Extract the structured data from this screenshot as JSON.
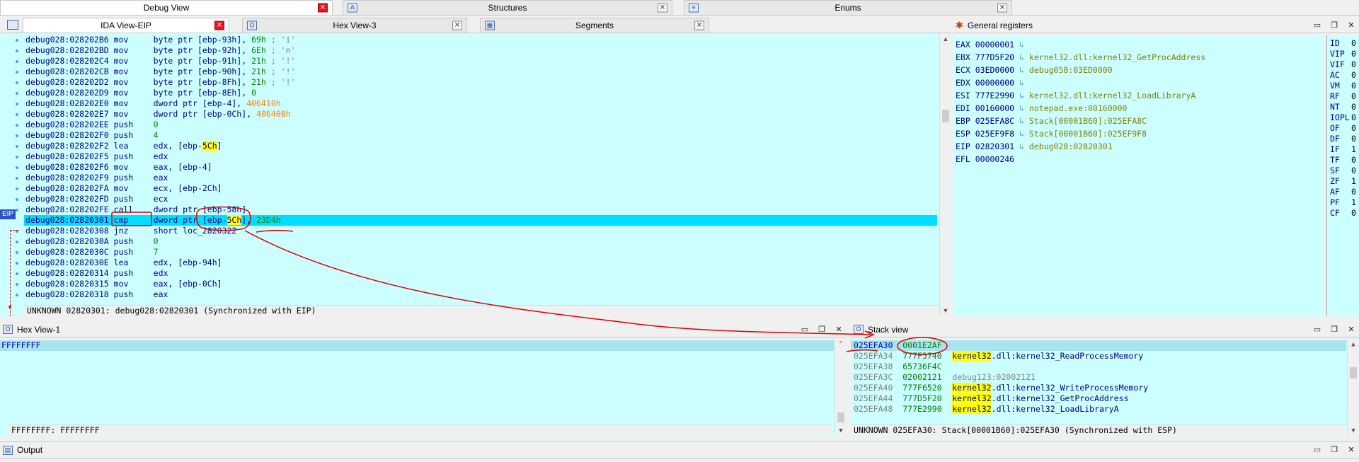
{
  "top_tabs": [
    {
      "label": "Debug View"
    },
    {
      "label": "Structures"
    },
    {
      "label": "Enums"
    }
  ],
  "ida_tabs": [
    {
      "label": "IDA View-EIP"
    },
    {
      "label": "Hex View-3"
    },
    {
      "label": "Segments"
    }
  ],
  "eip_marker": "EIP",
  "disasm": [
    {
      "addr": "debug028:028202B6",
      "mn": "mov",
      "op": "byte ptr [ebp-93h], ",
      "num": "69h",
      "cmt": " ; 'i'"
    },
    {
      "addr": "debug028:028202BD",
      "mn": "mov",
      "op": "byte ptr [ebp-92h], ",
      "num": "6Eh",
      "cmt": " ; 'n'"
    },
    {
      "addr": "debug028:028202C4",
      "mn": "mov",
      "op": "byte ptr [ebp-91h], ",
      "num": "21h",
      "cmt": " ; '!'"
    },
    {
      "addr": "debug028:028202CB",
      "mn": "mov",
      "op": "byte ptr [ebp-90h], ",
      "num": "21h",
      "cmt": " ; '!'"
    },
    {
      "addr": "debug028:028202D2",
      "mn": "mov",
      "op": "byte ptr [ebp-8Fh], ",
      "num": "21h",
      "cmt": " ; '!'"
    },
    {
      "addr": "debug028:028202D9",
      "mn": "mov",
      "op": "byte ptr [ebp-8Eh], ",
      "num": "0",
      "cmt": ""
    },
    {
      "addr": "debug028:028202E0",
      "mn": "mov",
      "op": "dword ptr [ebp-4], ",
      "num": "406410h",
      "cmt": "",
      "orange": true
    },
    {
      "addr": "debug028:028202E7",
      "mn": "mov",
      "op": "dword ptr [ebp-0Ch], ",
      "num": "406408h",
      "cmt": "",
      "orange": true
    },
    {
      "addr": "debug028:028202EE",
      "mn": "push",
      "op": "",
      "num": "0",
      "cmt": ""
    },
    {
      "addr": "debug028:028202F0",
      "mn": "push",
      "op": "",
      "num": "4",
      "cmt": ""
    },
    {
      "addr": "debug028:028202F2",
      "mn": "lea",
      "op": "edx, [ebp-",
      "hl": "5Ch",
      "op2": "]",
      "num": "",
      "cmt": ""
    },
    {
      "addr": "debug028:028202F5",
      "mn": "push",
      "op": "edx",
      "num": "",
      "cmt": ""
    },
    {
      "addr": "debug028:028202F6",
      "mn": "mov",
      "op": "eax, [ebp-4]",
      "num": "",
      "cmt": ""
    },
    {
      "addr": "debug028:028202F9",
      "mn": "push",
      "op": "eax",
      "num": "",
      "cmt": ""
    },
    {
      "addr": "debug028:028202FA",
      "mn": "mov",
      "op": "ecx, [ebp-2Ch]",
      "num": "",
      "cmt": ""
    },
    {
      "addr": "debug028:028202FD",
      "mn": "push",
      "op": "ecx",
      "num": "",
      "cmt": ""
    },
    {
      "addr": "debug028:028202FE",
      "mn": "call",
      "op": "dword ptr [ebp-58h]",
      "num": "",
      "cmt": ""
    },
    {
      "addr": "debug028:02820301",
      "mn": "cmp",
      "op": "dword ptr [ebp-",
      "hl": "5Ch",
      "op2": "], ",
      "num": "23D4h",
      "cmt": "",
      "eip": true
    },
    {
      "addr": "debug028:02820308",
      "mn": "jnz",
      "op": "short loc_2820322",
      "num": "",
      "cmt": ""
    },
    {
      "addr": "debug028:0282030A",
      "mn": "push",
      "op": "",
      "num": "0",
      "cmt": ""
    },
    {
      "addr": "debug028:0282030C",
      "mn": "push",
      "op": "",
      "num": "7",
      "cmt": ""
    },
    {
      "addr": "debug028:0282030E",
      "mn": "lea",
      "op": "edx, [ebp-94h]",
      "num": "",
      "cmt": ""
    },
    {
      "addr": "debug028:02820314",
      "mn": "push",
      "op": "edx",
      "num": "",
      "cmt": ""
    },
    {
      "addr": "debug028:02820315",
      "mn": "mov",
      "op": "eax, [ebp-0Ch]",
      "num": "",
      "cmt": ""
    },
    {
      "addr": "debug028:02820318",
      "mn": "push",
      "op": "eax",
      "num": "",
      "cmt": ""
    }
  ],
  "ida_status": "UNKNOWN 02820301: debug028:02820301 (Synchronized with EIP)",
  "registers_title": "General registers",
  "registers": [
    {
      "name": "EAX",
      "val": "00000001",
      "sym": ""
    },
    {
      "name": "EBX",
      "val": "777D5F20",
      "sym": "kernel32.dll:kernel32_GetProcAddress"
    },
    {
      "name": "ECX",
      "val": "03ED0000",
      "sym": "debug058:03ED0000"
    },
    {
      "name": "EDX",
      "val": "00000000",
      "sym": ""
    },
    {
      "name": "ESI",
      "val": "777E2990",
      "sym": "kernel32.dll:kernel32_LoadLibraryA"
    },
    {
      "name": "EDI",
      "val": "00160000",
      "sym": "notepad.exe:00160000"
    },
    {
      "name": "EBP",
      "val": "025EFA8C",
      "sym": "Stack[00001B60]:025EFA8C"
    },
    {
      "name": "ESP",
      "val": "025EF9F8",
      "sym": "Stack[00001B60]:025EF9F8"
    },
    {
      "name": "EIP",
      "val": "02820301",
      "sym": "debug028:02820301"
    },
    {
      "name": "EFL",
      "val": "00000246",
      "sym": ""
    }
  ],
  "flags": [
    {
      "name": "ID",
      "val": "0"
    },
    {
      "name": "VIP",
      "val": "0"
    },
    {
      "name": "VIF",
      "val": "0"
    },
    {
      "name": "AC",
      "val": "0"
    },
    {
      "name": "VM",
      "val": "0"
    },
    {
      "name": "RF",
      "val": "0"
    },
    {
      "name": "NT",
      "val": "0"
    },
    {
      "name": "IOPL",
      "val": "0"
    },
    {
      "name": "OF",
      "val": "0"
    },
    {
      "name": "DF",
      "val": "0"
    },
    {
      "name": "IF",
      "val": "1"
    },
    {
      "name": "TF",
      "val": "0"
    },
    {
      "name": "SF",
      "val": "0"
    },
    {
      "name": "ZF",
      "val": "1"
    },
    {
      "name": "AF",
      "val": "0"
    },
    {
      "name": "PF",
      "val": "1"
    },
    {
      "name": "CF",
      "val": "0"
    }
  ],
  "hex_title": "Hex View-1",
  "hex_line": "FFFFFFFF",
  "hex_status": "FFFFFFFF: FFFFFFFF",
  "stack_title": "Stack view",
  "stack": [
    {
      "addr": "025EFA30",
      "val": "0001E2AF",
      "pre": "",
      "hl": "",
      "post": "",
      "gray": ""
    },
    {
      "addr": "025EFA34",
      "val": "777F5740",
      "pre": "",
      "hl": "kernel32",
      "post": ".dll:kernel32_ReadProcessMemory",
      "gray": ""
    },
    {
      "addr": "025EFA38",
      "val": "65736F4C",
      "pre": "",
      "hl": "",
      "post": "",
      "gray": ""
    },
    {
      "addr": "025EFA3C",
      "val": "02002121",
      "pre": "",
      "hl": "",
      "post": "",
      "gray": "debug123:02002121"
    },
    {
      "addr": "025EFA40",
      "val": "777F6520",
      "pre": "",
      "hl": "kernel32",
      "post": ".dll:kernel32_WriteProcessMemory",
      "gray": ""
    },
    {
      "addr": "025EFA44",
      "val": "777D5F20",
      "pre": "",
      "hl": "kernel32",
      "post": ".dll:kernel32_GetProcAddress",
      "gray": ""
    },
    {
      "addr": "025EFA48",
      "val": "777E2990",
      "pre": "",
      "hl": "kernel32",
      "post": ".dll:kernel32_LoadLibraryA",
      "gray": ""
    }
  ],
  "stack_status": "UNKNOWN 025EFA30: Stack[00001B60]:025EFA30 (Synchronized with ESP)",
  "output_title": "Output",
  "colors": {
    "pane_bg": "#ccffff",
    "eip_line": "#00ddff",
    "annotation": "#e00000"
  }
}
